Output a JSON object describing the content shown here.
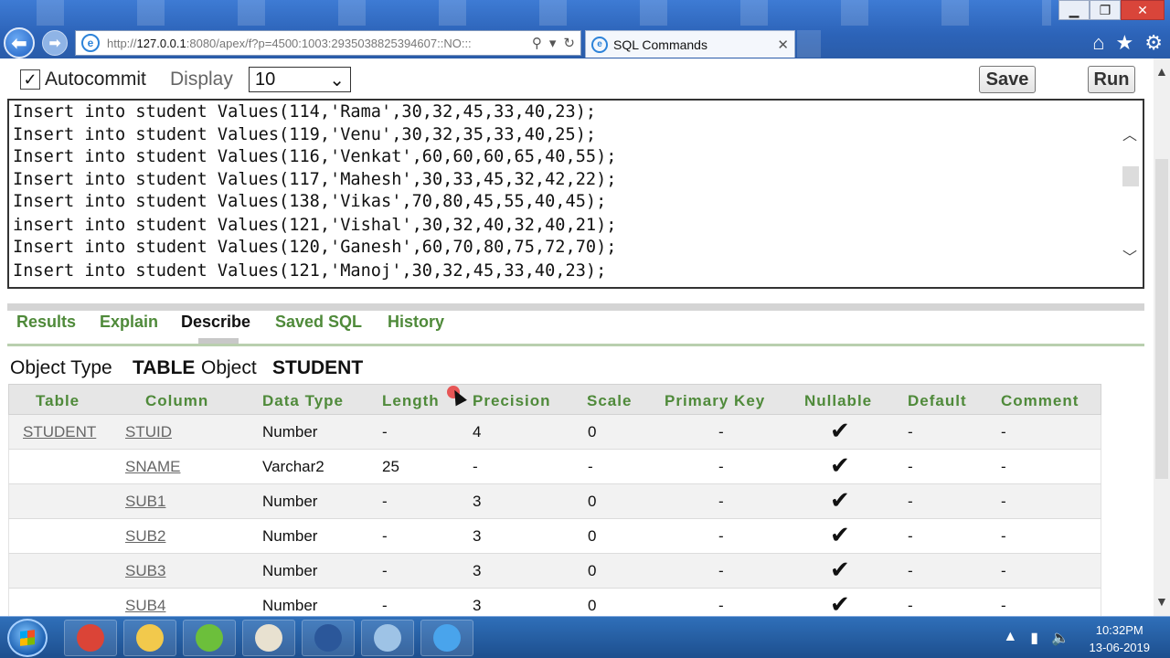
{
  "browser": {
    "url_prefix": "http://",
    "url_host": "127.0.0.1",
    "url_rest": ":8080/apex/f?p=4500:1003:2935038825394607::NO:::",
    "tab_title": "SQL Commands",
    "ie_glyph": "e"
  },
  "toolbar": {
    "autocommit_label": "Autocommit",
    "autocommit_checked": "✓",
    "display_label": "Display",
    "display_value": "10",
    "save_label": "Save",
    "run_label": "Run"
  },
  "editor": {
    "lines": [
      "Insert into student Values(114,'Rama',30,32,45,33,40,23);",
      "Insert into student Values(119,'Venu',30,32,35,33,40,25);",
      "Insert into student Values(116,'Venkat',60,60,60,65,40,55);",
      "Insert into student Values(117,'Mahesh',30,33,45,32,42,22);",
      "Insert into student Values(138,'Vikas',70,80,45,55,40,45);",
      "insert into student Values(121,'Vishal',30,32,40,32,40,21);",
      "Insert into student Values(120,'Ganesh',60,70,80,75,72,70);",
      "Insert into student Values(121,'Manoj',30,32,45,33,40,23);"
    ]
  },
  "result_tabs": [
    "Results",
    "Explain",
    "Describe",
    "Saved SQL",
    "History"
  ],
  "active_tab": "Describe",
  "object_info": {
    "type_label": "Object Type",
    "type_value": "TABLE",
    "object_label": "Object",
    "object_value": "STUDENT"
  },
  "describe_table": {
    "headers": [
      "Table",
      "Column",
      "Data Type",
      "Length",
      "Precision",
      "Scale",
      "Primary Key",
      "Nullable",
      "Default",
      "Comment"
    ],
    "rows": [
      [
        "STUDENT",
        "STUID",
        "Number",
        "-",
        "4",
        "0",
        "-",
        "✔",
        "-",
        "-"
      ],
      [
        "",
        "SNAME",
        "Varchar2",
        "25",
        "-",
        "-",
        "-",
        "✔",
        "-",
        "-"
      ],
      [
        "",
        "SUB1",
        "Number",
        "-",
        "3",
        "0",
        "-",
        "✔",
        "-",
        "-"
      ],
      [
        "",
        "SUB2",
        "Number",
        "-",
        "3",
        "0",
        "-",
        "✔",
        "-",
        "-"
      ],
      [
        "",
        "SUB3",
        "Number",
        "-",
        "3",
        "0",
        "-",
        "✔",
        "-",
        "-"
      ],
      [
        "",
        "SUB4",
        "Number",
        "-",
        "3",
        "0",
        "-",
        "✔",
        "-",
        "-"
      ]
    ]
  },
  "taskbar": {
    "apps": [
      {
        "icon": "chrome-icon",
        "color": "#db4437"
      },
      {
        "icon": "folder-icon",
        "color": "#f2c94c"
      },
      {
        "icon": "utorrent-icon",
        "color": "#6cbf3b"
      },
      {
        "icon": "tally-icon",
        "color": "#e8e1d0"
      },
      {
        "icon": "word-icon",
        "color": "#2b579a"
      },
      {
        "icon": "notepad-icon",
        "color": "#9ec3e6"
      },
      {
        "icon": "internet-explorer-icon",
        "color": "#49a4ec"
      }
    ],
    "time": "10:32PM",
    "date": "13-06-2019"
  },
  "colors": {
    "accent_green": "#4f8a3a",
    "chrome_blue": "#2c63b8"
  }
}
